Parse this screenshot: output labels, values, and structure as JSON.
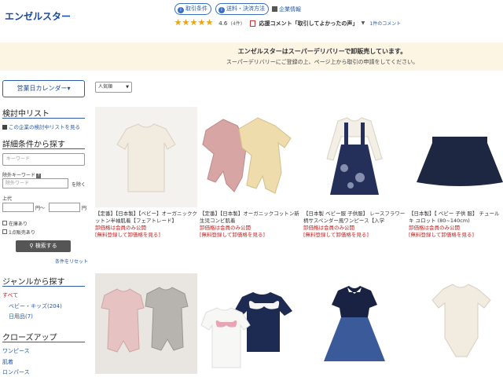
{
  "header": {
    "shop_name": "エンゼルスター",
    "transaction_terms": "取引条件",
    "shipping_payment": "送料・決済方法",
    "company_info": "企業情報",
    "rating_score": "4.6",
    "rating_count": "(4件)",
    "comment_label": "応援コメント「取引してよかったの声」",
    "comment_count": "1件のコメント"
  },
  "banner": {
    "line1": "エンゼルスターはスーパーデリバリーで卸販売しています。",
    "line2": "スーパーデリバリーにご登録の上、ページ上から取引の申請をしてください。"
  },
  "sidebar": {
    "calendar_button": "営業日カレンダー▾",
    "review_list_heading": "検討中リスト",
    "review_list_link": "この企業の検討中リストを見る",
    "search_heading": "詳細条件から探す",
    "keyword_placeholder": "キーワード",
    "exclude_label": "除外キーワード",
    "exclude_placeholder": "除外ワード",
    "exclude_suffix": "を除く",
    "price_label": "上代",
    "price_unit_from": "円〜",
    "price_unit_to": "円",
    "in_stock": "在庫あり",
    "one_lot": "1点販売あり",
    "search_button": "検索する",
    "reset_link": "条件をリセット",
    "genre_heading": "ジャンルから探す",
    "genre_items": [
      "すべて",
      "ベビー・キッズ(204)",
      "日用品(7)"
    ],
    "closeup_heading": "クローズアップ",
    "closeup_items": [
      "ワンピース",
      "肌着",
      "ロンパース"
    ]
  },
  "sort": {
    "selected": "人気順"
  },
  "products": [
    {
      "title": "【定番】【日本製】【ベビー】オーガニッククットン半袖肌着【フェアトレード】",
      "member_price": "卸価格は会員のみ公開",
      "free_reg": "[無料登録して卸価格を見る]"
    },
    {
      "title": "【定番】【日本製】オーガニックコットン新生児コンビ肌着",
      "member_price": "卸価格は会員のみ公開",
      "free_reg": "[無料登録して卸価格を見る]"
    },
    {
      "title": "【日本製 ベビー服 子供服】 レースフラワー柄サスペンダー風ワンピース【入学",
      "member_price": "卸価格は会員のみ公開",
      "free_reg": "[無料登録して卸価格を見る]"
    },
    {
      "title": "【日本製】【 ベビー 子供 服】 チュールキ ユロット (80~140cm)",
      "member_price": "卸価格は会員のみ公開",
      "free_reg": "[無料登録して卸価格を見る]"
    },
    {
      "title": "",
      "member_price": "",
      "free_reg": ""
    },
    {
      "title": "",
      "member_price": "",
      "free_reg": ""
    },
    {
      "title": "",
      "member_price": "",
      "free_reg": ""
    },
    {
      "title": "",
      "member_price": "",
      "free_reg": ""
    }
  ],
  "colors": {
    "brand_blue": "#1a4aa0",
    "accent_red": "#c02020",
    "star": "#f4a300",
    "banner_bg": "#fdf5e4"
  }
}
